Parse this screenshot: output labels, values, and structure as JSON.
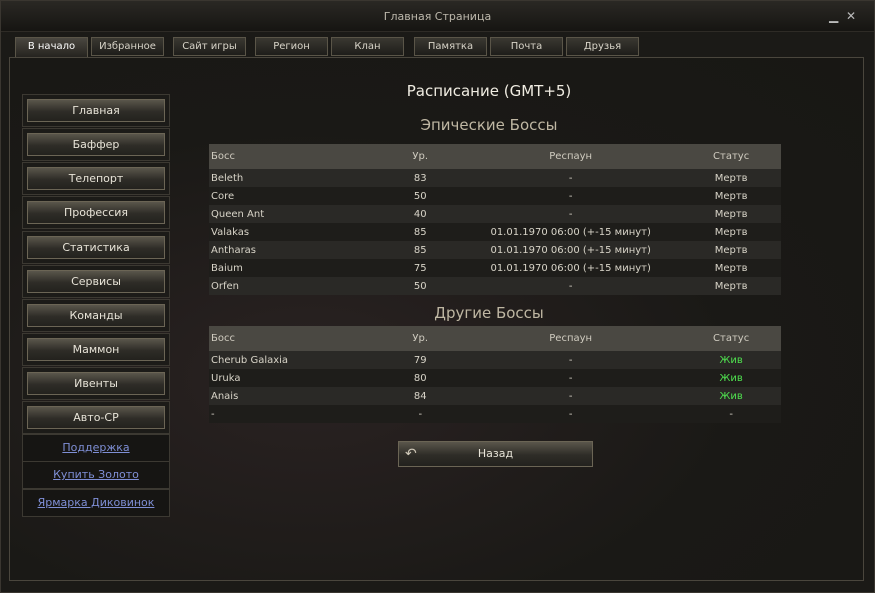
{
  "window": {
    "title": "Главная Страница"
  },
  "tabs": [
    "В начало",
    "Избранное",
    "Сайт игры",
    "Регион",
    "Клан",
    "Памятка",
    "Почта",
    "Друзья"
  ],
  "sidebar": {
    "buttons": [
      "Главная",
      "Баффер",
      "Телепорт",
      "Профессия",
      "Статистика",
      "Сервисы",
      "Команды",
      "Маммон",
      "Ивенты",
      "Авто-СР"
    ],
    "links": [
      "Поддержка",
      "Купить Золото",
      "Ярмарка Диковинок"
    ]
  },
  "main": {
    "title": "Расписание (GMT+5)",
    "epic_heading": "Эпические Боссы",
    "other_heading": "Другие Боссы",
    "columns": [
      "Босс",
      "Ур.",
      "Респаун",
      "Статус"
    ],
    "epic_rows": [
      {
        "boss": "Beleth",
        "level": "83",
        "respawn": "-",
        "status": "Мертв"
      },
      {
        "boss": "Core",
        "level": "50",
        "respawn": "-",
        "status": "Мертв"
      },
      {
        "boss": "Queen Ant",
        "level": "40",
        "respawn": "-",
        "status": "Мертв"
      },
      {
        "boss": "Valakas",
        "level": "85",
        "respawn": "01.01.1970 06:00 (+-15 минут)",
        "status": "Мертв"
      },
      {
        "boss": "Antharas",
        "level": "85",
        "respawn": "01.01.1970 06:00 (+-15 минут)",
        "status": "Мертв"
      },
      {
        "boss": "Baium",
        "level": "75",
        "respawn": "01.01.1970 06:00 (+-15 минут)",
        "status": "Мертв"
      },
      {
        "boss": "Orfen",
        "level": "50",
        "respawn": "-",
        "status": "Мертв"
      }
    ],
    "other_rows": [
      {
        "boss": "Cherub Galaxia",
        "level": "79",
        "respawn": "-",
        "status": "Жив"
      },
      {
        "boss": "Uruka",
        "level": "80",
        "respawn": "-",
        "status": "Жив"
      },
      {
        "boss": "Anais",
        "level": "84",
        "respawn": "-",
        "status": "Жив"
      },
      {
        "boss": "-",
        "level": "-",
        "respawn": "-",
        "status": "-"
      }
    ],
    "back_label": "Назад"
  },
  "colors": {
    "alive": "#4fe04f",
    "link": "#7f8fd6"
  },
  "icons": {
    "minimize": "minimize-icon",
    "close": "close-icon",
    "back": "back-arrow-icon"
  }
}
